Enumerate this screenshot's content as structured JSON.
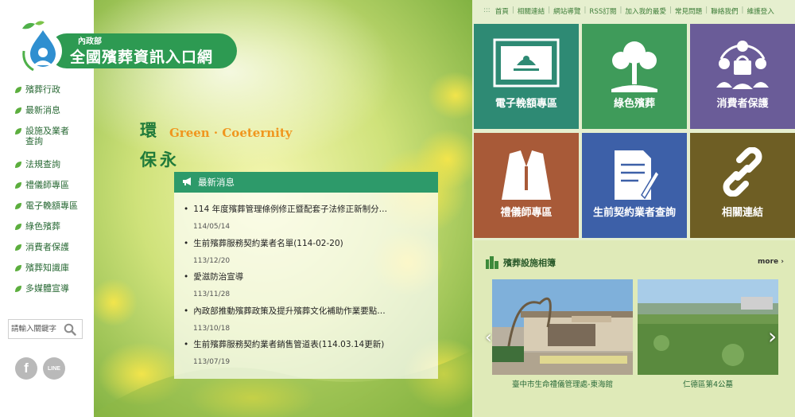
{
  "logo": {
    "org": "內政部",
    "title": "全國殯葬資訊入口網"
  },
  "sidebar": {
    "items": [
      {
        "label": "殯葬行政"
      },
      {
        "label": "最新消息"
      },
      {
        "label": "設施及業者\n查詢"
      },
      {
        "label": "法規查詢"
      },
      {
        "label": "禮儀師專區"
      },
      {
        "label": "電子輓額專區"
      },
      {
        "label": "綠色殯葬"
      },
      {
        "label": "消費者保護"
      },
      {
        "label": "殯葬知識庫"
      },
      {
        "label": "多媒體宣導"
      }
    ],
    "search": {
      "placeholder": "請輸入關鍵字"
    },
    "social": {
      "facebook": "f",
      "line": "LINE"
    }
  },
  "hero": {
    "tagline_en": "Green · Coeternity",
    "tagline_zh_1": "環",
    "tagline_zh_2": "保永"
  },
  "news": {
    "heading": "最新消息",
    "items": [
      {
        "title": "114 年度殯葬管理條例修正暨配套子法修正新制分…",
        "date": "114/05/14"
      },
      {
        "title": "生前殯葬服務契約業者名單(114-02-20)",
        "date": "113/12/20"
      },
      {
        "title": "愛滋防治宣導",
        "date": "113/11/28"
      },
      {
        "title": "內政部推動殯葬政策及提升殯葬文化補助作業要點…",
        "date": "113/10/18"
      },
      {
        "title": "生前殯葬服務契約業者銷售管道表(114.03.14更新)",
        "date": "113/07/19"
      }
    ]
  },
  "topnav": {
    "dots": ":::",
    "links": [
      "首頁",
      "相關連結",
      "網站導覽",
      "RSS訂閱",
      "加入我的最愛",
      "常見問題",
      "聯絡我們",
      "維護登入"
    ]
  },
  "tiles": [
    {
      "label": "電子輓額專區",
      "color": "#2e8a74",
      "icon": "plaque-icon"
    },
    {
      "label": "綠色殯葬",
      "color": "#3f9b5a",
      "icon": "tree-icon"
    },
    {
      "label": "消費者保護",
      "color": "#6a5c98",
      "icon": "consumer-icon"
    },
    {
      "label": "禮儀師專區",
      "color": "#a85a38",
      "icon": "suit-icon"
    },
    {
      "label": "生前契約業者查詢",
      "color": "#3d60a8",
      "icon": "contract-icon"
    },
    {
      "label": "相關連結",
      "color": "#6e5e24",
      "icon": "link-icon"
    }
  ],
  "album": {
    "heading": "殯葬設施相簿",
    "more": "more",
    "photos": [
      {
        "caption": "臺中市生命禮儀管理處-東海館"
      },
      {
        "caption": "仁德區第4公墓"
      }
    ]
  },
  "colors": {
    "brand_green": "#2d9a52",
    "news_header": "#2d9a6a",
    "right_bg": "#e6efcf"
  }
}
